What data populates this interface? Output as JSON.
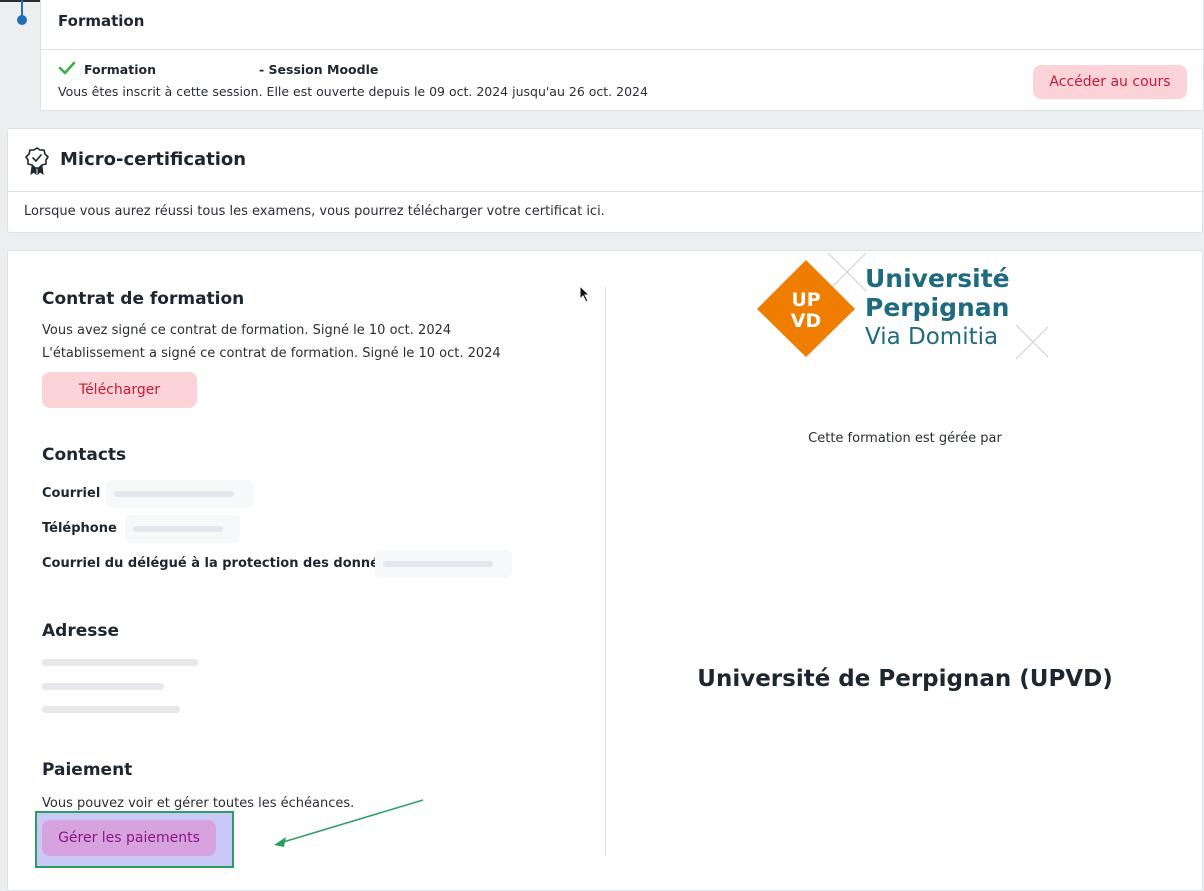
{
  "formation": {
    "title": "Formation",
    "session_name": "Formation",
    "session_suffix": "- Session Moodle",
    "description": "Vous êtes inscrit à cette session. Elle est ouverte depuis le 09 oct. 2024 jusqu'au 26 oct. 2024",
    "access_button": "Accéder au cours"
  },
  "micro_cert": {
    "title": "Micro-certification",
    "description": "Lorsque vous aurez réussi tous les examens, vous pourrez télécharger votre certificat ici."
  },
  "contract": {
    "title": "Contrat de formation",
    "line1": "Vous avez signé ce contrat de formation. Signé le 10 oct. 2024",
    "line2": "L'établissement a signé ce contrat de formation. Signé le 10 oct. 2024",
    "download_button": "Télécharger"
  },
  "contacts": {
    "title": "Contacts",
    "email_label": "Courriel",
    "phone_label": "Téléphone",
    "dpo_label": "Courriel du délégué à la protection des données"
  },
  "address": {
    "title": "Adresse"
  },
  "payment": {
    "title": "Paiement",
    "description": "Vous pouvez voir et gérer toutes les échéances.",
    "manage_button": "Gérer les paiements"
  },
  "institution": {
    "caption": "Cette formation est gérée par",
    "name": "Université de Perpignan (UPVD)",
    "logo_text": {
      "badge_top": "UP",
      "badge_bottom": "VD",
      "line1": "Université",
      "line2": "Perpignan",
      "line3": "Via Domitia"
    },
    "logo_colors": {
      "orange": "#ef7d00",
      "teal": "#1e6a7e"
    }
  },
  "colors": {
    "accent_pink_bg": "#fcd3d9",
    "accent_pink_text": "#c51b33",
    "highlight_border": "#2aa060",
    "timeline_blue": "#1f6fb5"
  }
}
